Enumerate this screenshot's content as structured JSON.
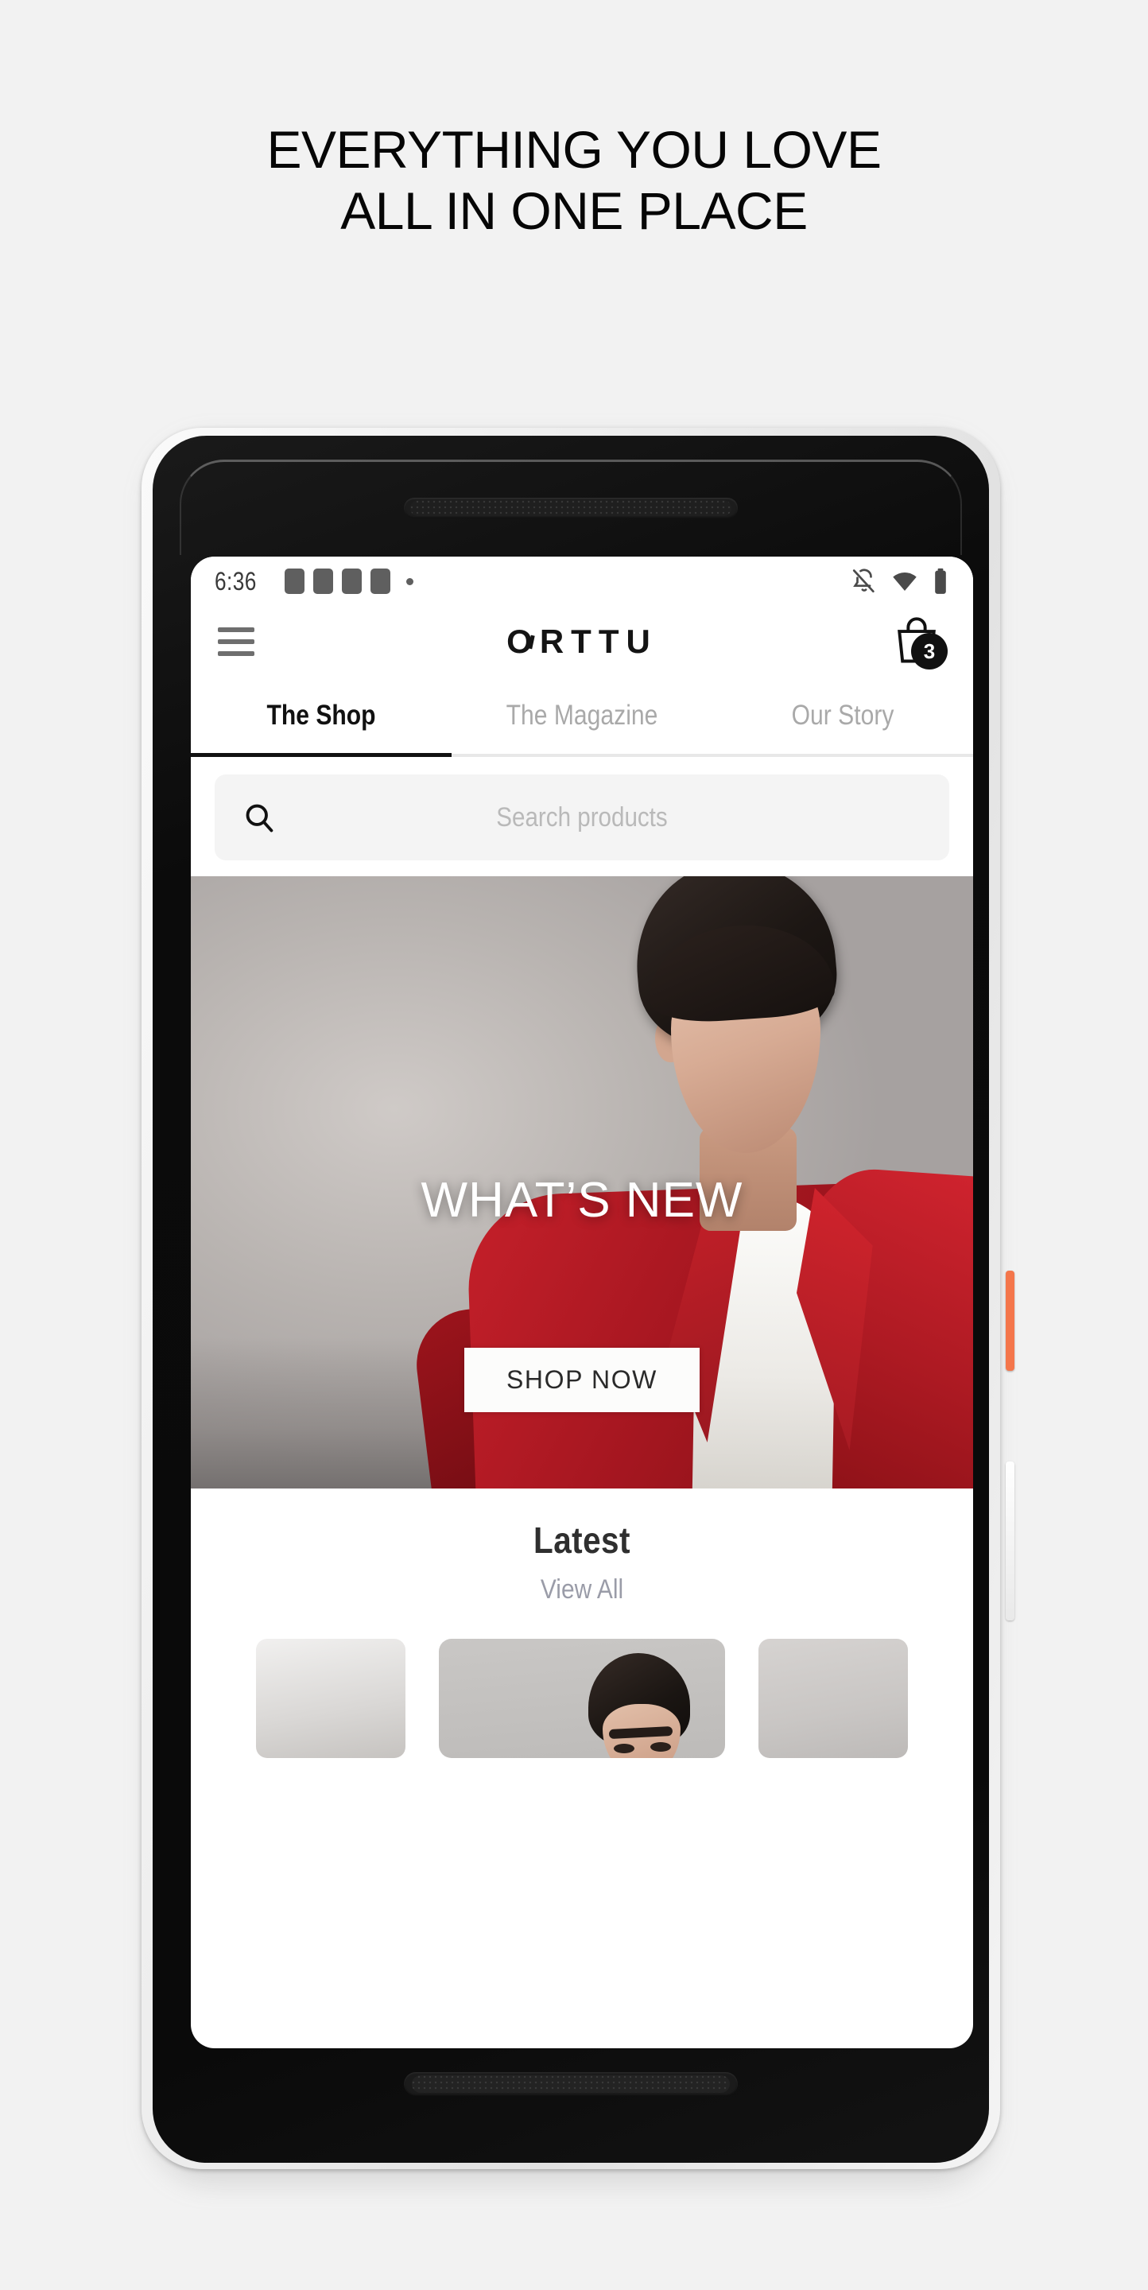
{
  "headline": {
    "line1": "EVERYTHING YOU LOVE",
    "line2": "ALL IN ONE PLACE"
  },
  "status_bar": {
    "time": "6:36",
    "notification_count": 4,
    "icons": [
      "notification-square",
      "notification-square",
      "notification-square",
      "notification-square",
      "notification-dot",
      "bell-off-icon",
      "wifi-icon",
      "battery-icon"
    ]
  },
  "app_bar": {
    "menu_icon": "hamburger-menu-icon",
    "logo_text": "ORTTU",
    "logo_prefix": "O",
    "logo_suffix": "RTTU",
    "cart_icon": "shopping-bag-icon",
    "cart_count": "3"
  },
  "tabs": [
    {
      "label": "The Shop",
      "active": true
    },
    {
      "label": "The Magazine",
      "active": false
    },
    {
      "label": "Our Story",
      "active": false
    }
  ],
  "search": {
    "icon": "search-icon",
    "placeholder": "Search products",
    "value": ""
  },
  "hero": {
    "title": "WHAT’S NEW",
    "button_label": "SHOP NOW",
    "image_alt": "Male model wearing a red blazer over a white shirt on a grey studio backdrop"
  },
  "latest": {
    "title": "Latest",
    "view_all_label": "View All",
    "cards": [
      {
        "alt": "product card partial left"
      },
      {
        "alt": "model in product card"
      },
      {
        "alt": "product card partial right"
      }
    ]
  },
  "device": {
    "power_button": "power-button",
    "volume_button": "volume-rocker",
    "speaker_top": "earpiece-speaker",
    "speaker_bottom": "bottom-speaker",
    "camera": "front-camera"
  },
  "colors": {
    "page_background": "#f2f2f2",
    "text_primary": "#060606",
    "tab_inactive": "#a9a9a9",
    "tab_active": "#111111",
    "search_field": "#f4f4f4",
    "placeholder": "#b9b9b9",
    "accent_red": "#c5202a",
    "power_button": "#f4764b",
    "view_all": "#9a9ca8",
    "badge_background": "#111111"
  }
}
